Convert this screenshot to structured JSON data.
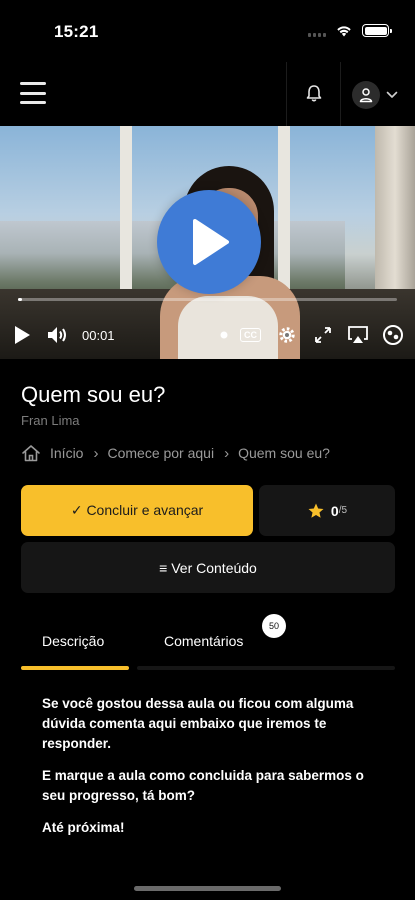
{
  "status_bar": {
    "time": "15:21"
  },
  "nav": {
    "menu_icon": "hamburger-menu-icon",
    "notification_icon": "bell-icon",
    "profile_icon": "user-icon"
  },
  "video": {
    "current_time": "00:01",
    "progress_fraction": 0.01,
    "cc_label": "CC",
    "play_color": "#3f7bd6"
  },
  "lesson": {
    "title": "Quem sou eu?",
    "author": "Fran Lima"
  },
  "breadcrumb": {
    "items": [
      "Início",
      "Comece por aqui",
      "Quem sou eu?"
    ]
  },
  "actions": {
    "complete_label": "✓ Concluir e avançar",
    "rating_value": "0",
    "rating_max": "/5",
    "content_label": "≡ Ver Conteúdo",
    "accent_color": "#f8bf2b"
  },
  "tabs": {
    "items": [
      {
        "label": "Descrição",
        "active": true
      },
      {
        "label": "Comentários",
        "active": false,
        "badge": "50"
      }
    ]
  },
  "description": {
    "paragraphs": [
      "Se você gostou dessa aula ou ficou com alguma dúvida comenta aqui embaixo que iremos te responder.",
      "E marque a aula como concluida para sabermos o seu progresso, tá bom?",
      "Até próxima!"
    ]
  }
}
